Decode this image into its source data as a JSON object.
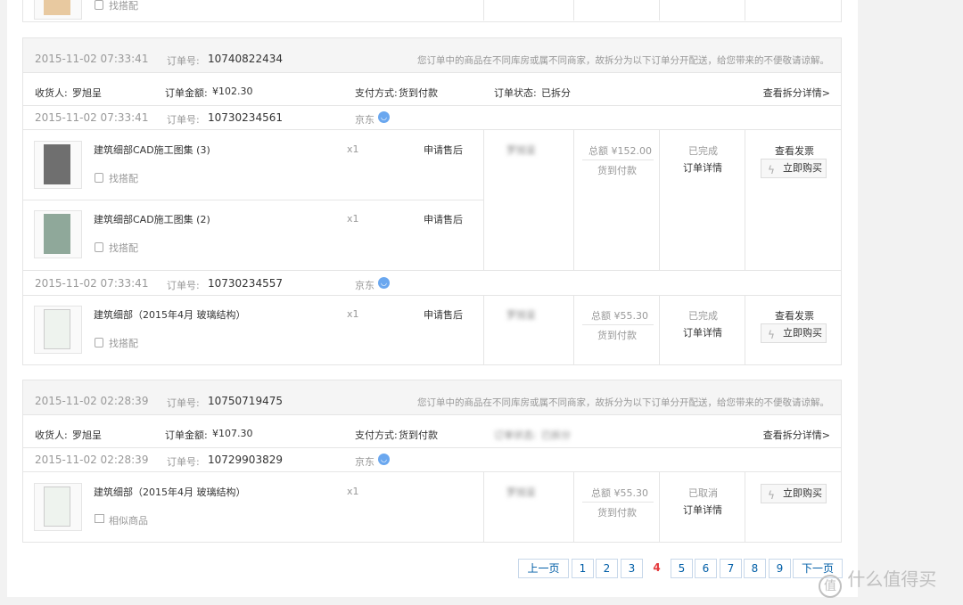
{
  "top_partial": {
    "match_label": "找搭配"
  },
  "order1": {
    "date": "2015-11-02 07:33:41",
    "order_no_label": "订单号:",
    "order_no": "10740822434",
    "split_notice": "您订单中的商品在不同库房或属不同商家，故拆分为以下订单分开配送，给您带来的不便敬请谅解。",
    "receiver_label": "收货人:",
    "receiver": "罗旭呈",
    "amount_label": "订单金额:",
    "amount": "¥102.30",
    "pay_label": "支付方式:",
    "pay": "货到付款",
    "status_label": "订单状态:",
    "status": "已拆分",
    "split_detail_link": "查看拆分详情>",
    "subs": [
      {
        "date": "2015-11-02 07:33:41",
        "order_no_label": "订单号:",
        "order_no": "10730234561",
        "shop": "京东",
        "items": [
          {
            "title": "建筑细部CAD施工图集 (3)",
            "qty": "x1",
            "after_sale": "申请售后",
            "match": "找搭配"
          },
          {
            "title": "建筑细部CAD施工图集 (2)",
            "qty": "x1",
            "after_sale": "申请售后",
            "match": "找搭配"
          }
        ],
        "consignee": "罗旭呈",
        "total": "总额 ¥152.00",
        "payment": "货到付款",
        "state": "已完成",
        "detail": "订单详情",
        "invoice": "查看发票",
        "buy": "立即购买"
      },
      {
        "date": "2015-11-02 07:33:41",
        "order_no_label": "订单号:",
        "order_no": "10730234557",
        "shop": "京东",
        "items": [
          {
            "title": "建筑细部（2015年4月 玻璃结构）",
            "qty": "x1",
            "after_sale": "申请售后",
            "match": "找搭配"
          }
        ],
        "consignee": "罗旭呈",
        "total": "总额 ¥55.30",
        "payment": "货到付款",
        "state": "已完成",
        "detail": "订单详情",
        "invoice": "查看发票",
        "buy": "立即购买"
      }
    ]
  },
  "order2": {
    "date": "2015-11-02 02:28:39",
    "order_no_label": "订单号:",
    "order_no": "10750719475",
    "split_notice": "您订单中的商品在不同库房或属不同商家，故拆分为以下订单分开配送，给您带来的不便敬请谅解。",
    "receiver_label": "收货人:",
    "receiver": "罗旭呈",
    "amount_label": "订单金额:",
    "amount": "¥107.30",
    "pay_label": "支付方式:",
    "pay": "货到付款",
    "status_label": "订单状态:",
    "status": "已拆分",
    "split_detail_link": "查看拆分详情>",
    "sub": {
      "date": "2015-11-02 02:28:39",
      "order_no_label": "订单号:",
      "order_no": "10729903829",
      "shop": "京东",
      "item": {
        "title": "建筑细部（2015年4月 玻璃结构）",
        "qty": "x1",
        "similar": "相似商品"
      },
      "consignee": "罗旭呈",
      "total": "总额 ¥55.30",
      "payment": "货到付款",
      "state": "已取消",
      "detail": "订单详情",
      "buy": "立即购买"
    }
  },
  "pagination": {
    "prev": "上一页",
    "pages": [
      "1",
      "2",
      "3",
      "4",
      "5",
      "6",
      "7",
      "8",
      "9"
    ],
    "current": "4",
    "next": "下一页"
  },
  "watermark": {
    "icon": "值",
    "text": "什么值得买"
  },
  "colors": {
    "link": "#005ea7",
    "current_page": "#e4393c",
    "chat": "#6aa7ef"
  }
}
